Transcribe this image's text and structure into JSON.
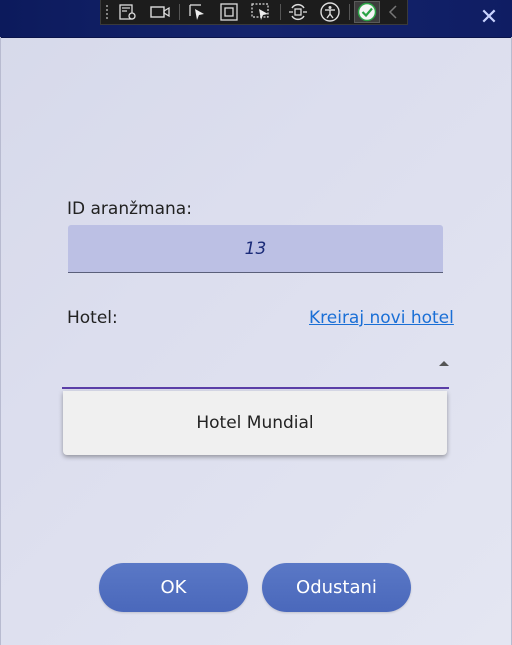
{
  "window": {
    "close_glyph": "✕"
  },
  "debug_toolbar": {
    "icons": [
      "live-visual-tree-icon",
      "video-icon",
      "select-element-icon",
      "display-layout-adorners-icon",
      "track-focus-icon",
      "hot-reload-icon",
      "accessibility-icon",
      "binding-check-icon",
      "collapse-chevron-icon"
    ]
  },
  "form": {
    "id_label": "ID aranžmana:",
    "id_value": "13",
    "hotel_label": "Hotel:",
    "create_hotel_link": "Kreiraj novi hotel",
    "hotel_selected": "",
    "hotel_options": [
      "Hotel Mundial"
    ]
  },
  "buttons": {
    "ok_label": "OK",
    "cancel_label": "Odustani"
  },
  "colors": {
    "titlebar": "#0f1d63",
    "field_bg": "#bcc0e4",
    "link": "#1a6fd6",
    "button": "#4e6cbe",
    "combo_underline": "#5b3fa8"
  }
}
